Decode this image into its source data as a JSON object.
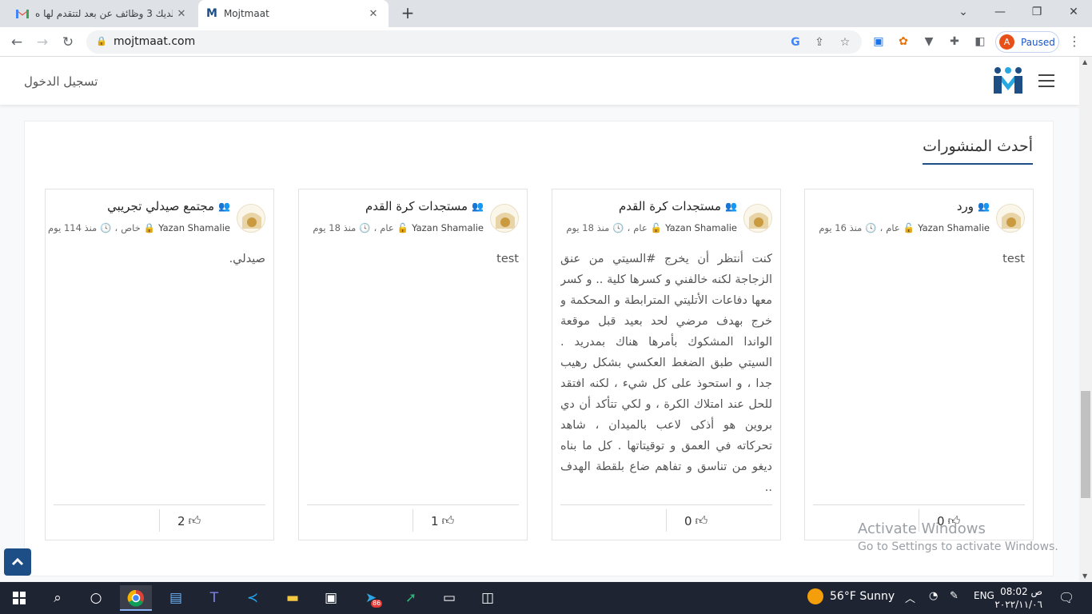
{
  "browser": {
    "tabs": [
      {
        "title": "لديك 3 وظائف عن بعد لتتقدم لها ه...",
        "icon": "gmail-icon",
        "active": false
      },
      {
        "title": "Mojtmaat",
        "icon": "mojtmaat-icon",
        "active": true
      }
    ],
    "url": "mojtmaat.com",
    "profile_initial": "A",
    "profile_status": "Paused"
  },
  "site": {
    "login_label": "تسجيل الدخول",
    "section_title": "أحدث المنشورات"
  },
  "posts": [
    {
      "group": "ورد",
      "author": "Yazan Shamalie",
      "visibility": "عام",
      "time": "منذ 16 يوم",
      "body": "test",
      "likes": "0"
    },
    {
      "group": "مستجدات كرة القدم",
      "author": "Yazan Shamalie",
      "visibility": "عام",
      "time": "منذ 18 يوم",
      "body": "كنت أنتظر أن يخرج #السيتي من عنق الزجاجة لكنه خالفني و كسرها كلية .. و كسر معها دفاعات الأتليتي المترابطة و المحكمة و خرج بهدف مرضي لحد بعيد قبل موقعة الواندا المشكوك بأمرها هناك بمدريد . السيتي طبق الضغط العكسي بشكل رهيب جدا ، و استحوذ على كل شيء ، لكنه افتقد للحل عند امتلاك الكرة ، و لكي تتأكد أن دي بروين هو أذكى لاعب بالميدان ، شاهد تحركاته في العمق و توقيتاتها . كل ما بناه ديغو من تناسق و تفاهم ضاع بلقطة الهدف ..",
      "likes": "0"
    },
    {
      "group": "مستجدات كرة القدم",
      "author": "Yazan Shamalie",
      "visibility": "عام",
      "time": "منذ 18 يوم",
      "body": "test",
      "likes": "1"
    },
    {
      "group": "مجتمع صيدلي تجريبي",
      "author": "Yazan Shamalie",
      "visibility": "خاص",
      "time": "منذ 114 يوم",
      "body": "صيدلي.",
      "likes": "2"
    }
  ],
  "watermark": {
    "line1": "Activate Windows",
    "line2": "Go to Settings to activate Windows."
  },
  "taskbar": {
    "weather": "56°F  Sunny",
    "language": "ENG",
    "time": "08:02 ص",
    "date": "٢٠٢٢/١١/٠٦",
    "telegram_badge": "86"
  }
}
